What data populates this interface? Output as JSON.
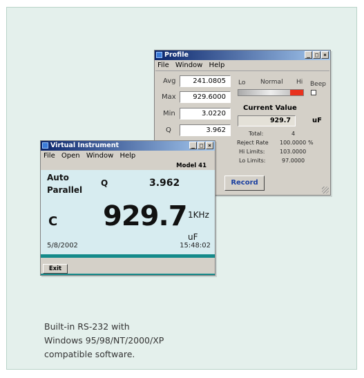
{
  "profile": {
    "title": "Profile",
    "controls": [
      "_",
      "□",
      "×"
    ],
    "menu": [
      "File",
      "Window",
      "Help"
    ],
    "stats": [
      {
        "label": "Avg",
        "value": "241.0805"
      },
      {
        "label": "Max",
        "value": "929.6000"
      },
      {
        "label": "Min",
        "value": "3.0220"
      },
      {
        "label": "Q",
        "value": "3.962"
      }
    ],
    "limit_labels": {
      "lo": "Lo",
      "normal": "Normal",
      "hi": "Hi",
      "beep": "Beep"
    },
    "current_value_title": "Current Value",
    "current_value": "929.7",
    "current_unit": "uF",
    "summary": [
      {
        "label": "Total:",
        "value": "4",
        "unit": ""
      },
      {
        "label": "Reject Rate",
        "value": "100.0000",
        "unit": "%"
      },
      {
        "label": "Hi Limits:",
        "value": "103.0000",
        "unit": ""
      },
      {
        "label": "Lo Limits:",
        "value": "97.0000",
        "unit": ""
      }
    ],
    "record_label": "Record"
  },
  "vi": {
    "title": "Virtual Instrument",
    "controls": [
      "_",
      "□",
      "×"
    ],
    "menu": [
      "File",
      "Open",
      "Window",
      "Help"
    ],
    "model": "Model 41",
    "mode_line1": "Auto",
    "mode_line2": "Parallel",
    "secondary_param": "Q",
    "secondary_value": "3.962",
    "primary_param": "C",
    "primary_value": "929.7",
    "frequency": "1KHz",
    "primary_unit": "uF",
    "date": "5/8/2002",
    "time": "15:48:02",
    "exit_label": "Exit"
  },
  "caption": {
    "line1": "Built-in RS-232 with",
    "line2": "Windows 95/98/NT/2000/XP",
    "line3": "compatible software."
  },
  "colors": {
    "card_bg": "#e4f0ec",
    "screen_bg": "#d7ecf0",
    "hi_indicator": "#e8321e",
    "teal_bar": "#138a8a"
  }
}
